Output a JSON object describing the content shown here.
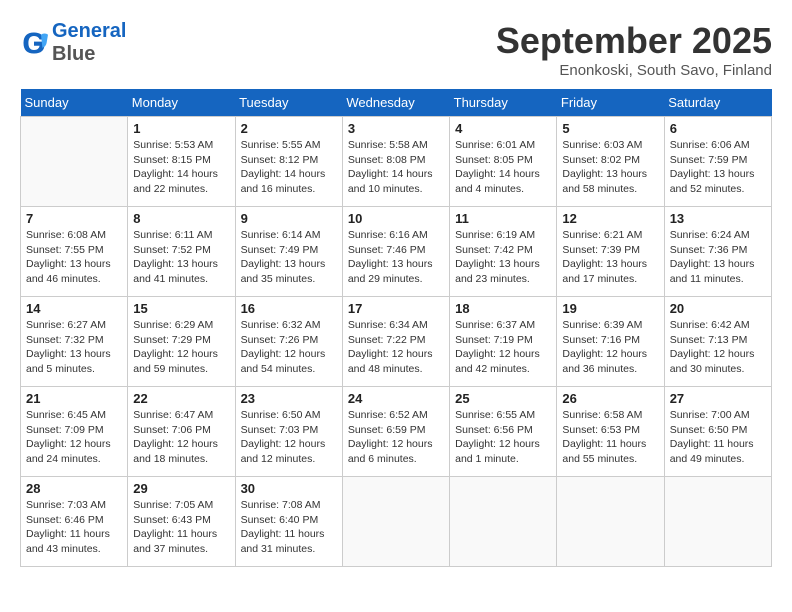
{
  "header": {
    "logo_line1": "General",
    "logo_line2": "Blue",
    "month": "September 2025",
    "location": "Enonkoski, South Savo, Finland"
  },
  "days_of_week": [
    "Sunday",
    "Monday",
    "Tuesday",
    "Wednesday",
    "Thursday",
    "Friday",
    "Saturday"
  ],
  "weeks": [
    [
      {
        "day": "",
        "content": ""
      },
      {
        "day": "1",
        "content": "Sunrise: 5:53 AM\nSunset: 8:15 PM\nDaylight: 14 hours\nand 22 minutes."
      },
      {
        "day": "2",
        "content": "Sunrise: 5:55 AM\nSunset: 8:12 PM\nDaylight: 14 hours\nand 16 minutes."
      },
      {
        "day": "3",
        "content": "Sunrise: 5:58 AM\nSunset: 8:08 PM\nDaylight: 14 hours\nand 10 minutes."
      },
      {
        "day": "4",
        "content": "Sunrise: 6:01 AM\nSunset: 8:05 PM\nDaylight: 14 hours\nand 4 minutes."
      },
      {
        "day": "5",
        "content": "Sunrise: 6:03 AM\nSunset: 8:02 PM\nDaylight: 13 hours\nand 58 minutes."
      },
      {
        "day": "6",
        "content": "Sunrise: 6:06 AM\nSunset: 7:59 PM\nDaylight: 13 hours\nand 52 minutes."
      }
    ],
    [
      {
        "day": "7",
        "content": "Sunrise: 6:08 AM\nSunset: 7:55 PM\nDaylight: 13 hours\nand 46 minutes."
      },
      {
        "day": "8",
        "content": "Sunrise: 6:11 AM\nSunset: 7:52 PM\nDaylight: 13 hours\nand 41 minutes."
      },
      {
        "day": "9",
        "content": "Sunrise: 6:14 AM\nSunset: 7:49 PM\nDaylight: 13 hours\nand 35 minutes."
      },
      {
        "day": "10",
        "content": "Sunrise: 6:16 AM\nSunset: 7:46 PM\nDaylight: 13 hours\nand 29 minutes."
      },
      {
        "day": "11",
        "content": "Sunrise: 6:19 AM\nSunset: 7:42 PM\nDaylight: 13 hours\nand 23 minutes."
      },
      {
        "day": "12",
        "content": "Sunrise: 6:21 AM\nSunset: 7:39 PM\nDaylight: 13 hours\nand 17 minutes."
      },
      {
        "day": "13",
        "content": "Sunrise: 6:24 AM\nSunset: 7:36 PM\nDaylight: 13 hours\nand 11 minutes."
      }
    ],
    [
      {
        "day": "14",
        "content": "Sunrise: 6:27 AM\nSunset: 7:32 PM\nDaylight: 13 hours\nand 5 minutes."
      },
      {
        "day": "15",
        "content": "Sunrise: 6:29 AM\nSunset: 7:29 PM\nDaylight: 12 hours\nand 59 minutes."
      },
      {
        "day": "16",
        "content": "Sunrise: 6:32 AM\nSunset: 7:26 PM\nDaylight: 12 hours\nand 54 minutes."
      },
      {
        "day": "17",
        "content": "Sunrise: 6:34 AM\nSunset: 7:22 PM\nDaylight: 12 hours\nand 48 minutes."
      },
      {
        "day": "18",
        "content": "Sunrise: 6:37 AM\nSunset: 7:19 PM\nDaylight: 12 hours\nand 42 minutes."
      },
      {
        "day": "19",
        "content": "Sunrise: 6:39 AM\nSunset: 7:16 PM\nDaylight: 12 hours\nand 36 minutes."
      },
      {
        "day": "20",
        "content": "Sunrise: 6:42 AM\nSunset: 7:13 PM\nDaylight: 12 hours\nand 30 minutes."
      }
    ],
    [
      {
        "day": "21",
        "content": "Sunrise: 6:45 AM\nSunset: 7:09 PM\nDaylight: 12 hours\nand 24 minutes."
      },
      {
        "day": "22",
        "content": "Sunrise: 6:47 AM\nSunset: 7:06 PM\nDaylight: 12 hours\nand 18 minutes."
      },
      {
        "day": "23",
        "content": "Sunrise: 6:50 AM\nSunset: 7:03 PM\nDaylight: 12 hours\nand 12 minutes."
      },
      {
        "day": "24",
        "content": "Sunrise: 6:52 AM\nSunset: 6:59 PM\nDaylight: 12 hours\nand 6 minutes."
      },
      {
        "day": "25",
        "content": "Sunrise: 6:55 AM\nSunset: 6:56 PM\nDaylight: 12 hours\nand 1 minute."
      },
      {
        "day": "26",
        "content": "Sunrise: 6:58 AM\nSunset: 6:53 PM\nDaylight: 11 hours\nand 55 minutes."
      },
      {
        "day": "27",
        "content": "Sunrise: 7:00 AM\nSunset: 6:50 PM\nDaylight: 11 hours\nand 49 minutes."
      }
    ],
    [
      {
        "day": "28",
        "content": "Sunrise: 7:03 AM\nSunset: 6:46 PM\nDaylight: 11 hours\nand 43 minutes."
      },
      {
        "day": "29",
        "content": "Sunrise: 7:05 AM\nSunset: 6:43 PM\nDaylight: 11 hours\nand 37 minutes."
      },
      {
        "day": "30",
        "content": "Sunrise: 7:08 AM\nSunset: 6:40 PM\nDaylight: 11 hours\nand 31 minutes."
      },
      {
        "day": "",
        "content": ""
      },
      {
        "day": "",
        "content": ""
      },
      {
        "day": "",
        "content": ""
      },
      {
        "day": "",
        "content": ""
      }
    ]
  ]
}
